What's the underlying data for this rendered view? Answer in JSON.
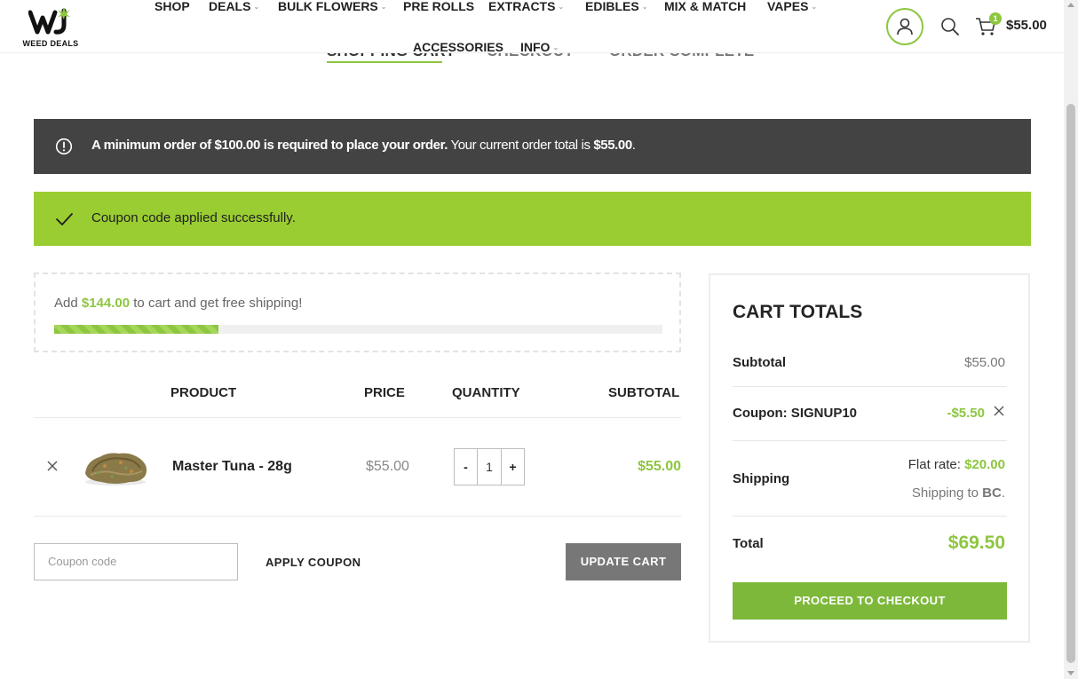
{
  "brand": {
    "name": "WEED DEALS",
    "accent": "#8dc63f"
  },
  "nav": {
    "items": [
      {
        "label": "SHOP",
        "dropdown": false
      },
      {
        "label": "DEALS",
        "dropdown": true
      },
      {
        "label": "BULK FLOWERS",
        "dropdown": true
      },
      {
        "label": "PRE ROLLS",
        "dropdown": false
      },
      {
        "label": "EXTRACTS",
        "dropdown": true
      },
      {
        "label": "EDIBLES",
        "dropdown": true
      },
      {
        "label": "MIX & MATCH",
        "dropdown": false
      },
      {
        "label": "VAPES",
        "dropdown": true
      },
      {
        "label": "ACCESSORIES",
        "dropdown": false
      },
      {
        "label": "INFO",
        "dropdown": true
      }
    ]
  },
  "header": {
    "icons": [
      "user-icon",
      "search-icon",
      "cart-icon"
    ],
    "cart_count": "1",
    "cart_total": "$55.00"
  },
  "steps": {
    "items": [
      "SHOPPING CART",
      "CHECKOUT",
      "ORDER COMPLETE"
    ],
    "active": 0
  },
  "notices": {
    "minimum": {
      "bold": "A minimum order of $100.00 is required to place your order.",
      "text": " Your current order total is ",
      "amount": "$55.00",
      "end": ".",
      "color": "#434343"
    },
    "coupon": {
      "text": "Coupon code applied successfully.",
      "color": "#9acd32"
    }
  },
  "free_shipping": {
    "prefix": "Add ",
    "amount": "$144.00",
    "suffix": " to cart and get free shipping!",
    "progress": 0.27
  },
  "cart_table": {
    "headers": [
      "PRODUCT",
      "PRICE",
      "QUANTITY",
      "SUBTOTAL"
    ],
    "rows": [
      {
        "name": "Master Tuna - 28g",
        "price": "$55.00",
        "quantity": "1",
        "subtotal": "$55.00"
      }
    ],
    "qty_minus": "-",
    "qty_plus": "+"
  },
  "actions": {
    "coupon_placeholder": "Coupon code",
    "apply_label": "APPLY COUPON",
    "update_label": "UPDATE CART"
  },
  "totals": {
    "title": "CART TOTALS",
    "subtotal_label": "Subtotal",
    "subtotal_value": "$55.00",
    "coupon_label": "Coupon: SIGNUP10",
    "coupon_value": "-$5.50",
    "shipping_label": "Shipping",
    "shipping_rate_label": "Flat rate: ",
    "shipping_rate_value": "$20.00",
    "shipping_to_label": "Shipping to ",
    "shipping_to_value": "BC",
    "shipping_to_end": ".",
    "total_label": "Total",
    "total_value": "$69.50",
    "checkout_label": "PROCEED TO CHECKOUT"
  }
}
